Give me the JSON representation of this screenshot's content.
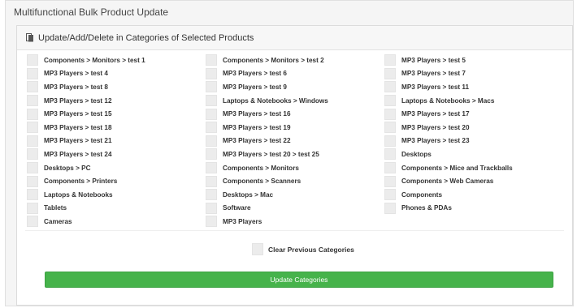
{
  "page": {
    "title": "Multifunctional Bulk Product Update"
  },
  "panel": {
    "heading": "Update/Add/Delete in Categories of Selected Products"
  },
  "categories": [
    "Components  >  Monitors  >  test 1",
    "Components  >  Monitors  >  test 2",
    "MP3 Players  >  test 5",
    "MP3 Players  >  test 4",
    "MP3 Players  >  test 6",
    "MP3 Players  >  test 7",
    "MP3 Players  >  test 8",
    "MP3 Players  >  test 9",
    "MP3 Players  >  test 11",
    "MP3 Players  >  test 12",
    "Laptops & Notebooks  >  Windows",
    "Laptops & Notebooks  >  Macs",
    "MP3 Players  >  test 15",
    "MP3 Players  >  test 16",
    "MP3 Players  >  test 17",
    "MP3 Players  >  test 18",
    "MP3 Players  >  test 19",
    "MP3 Players  >  test 20",
    "MP3 Players  >  test 21",
    "MP3 Players  >  test 22",
    "MP3 Players  >  test 23",
    "MP3 Players  >  test 24",
    "MP3 Players  >  test 20  >  test 25",
    "Desktops",
    "Desktops  >  PC",
    "Components  >  Monitors",
    "Components  >  Mice and Trackballs",
    "Components  >  Printers",
    "Components  >  Scanners",
    "Components  >  Web Cameras",
    "Laptops & Notebooks",
    "Desktops  >  Mac",
    "Components",
    "Tablets",
    "Software",
    "Phones & PDAs",
    "Cameras",
    "MP3 Players"
  ],
  "options": {
    "clear_label": "Clear Previous Categories"
  },
  "actions": {
    "update_label": "Update Categories"
  },
  "colors": {
    "button": "#46b34b",
    "checkbox": "#ececec"
  },
  "icons": {
    "heading": "document-edit-icon"
  }
}
